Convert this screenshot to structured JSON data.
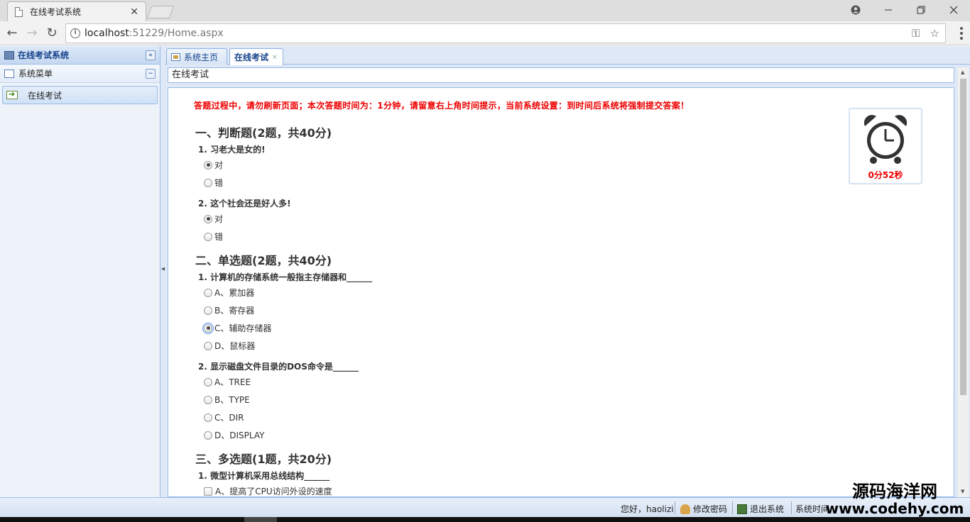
{
  "browser": {
    "tab_title": "在线考试系统",
    "tab_close": "✕",
    "url_host": "localhost",
    "url_rest": ":51229/Home.aspx"
  },
  "left_panel": {
    "title": "在线考试系统",
    "collapse_symbol": "«",
    "menu_header": "系统菜单",
    "menu_collapse_symbol": "−",
    "items": [
      {
        "label": "在线考试"
      }
    ]
  },
  "tabs": [
    {
      "label": "系统主页",
      "active": false
    },
    {
      "label": "在线考试",
      "active": true,
      "close": "×"
    }
  ],
  "content_title": "在线考试",
  "exam": {
    "notice": "答题过程中，请勿刷新页面；本次答题时间为：1分钟，请留意右上角时间提示，当前系统设置：到时间后系统将强制提交答案！",
    "timer": "0分52秒",
    "sections": [
      {
        "title": "一、判断题(2题，共40分)",
        "questions": [
          {
            "title": "1. 习老大是女的!",
            "options": [
              "对",
              "错"
            ],
            "selected": 0
          },
          {
            "title": "2. 这个社会还是好人多!",
            "options": [
              "对",
              "错"
            ],
            "selected": 0
          }
        ]
      },
      {
        "title": "二、单选题(2题，共40分)",
        "questions": [
          {
            "title": "1. 计算机的存储系统一般指主存储器和______",
            "options": [
              "A、累加器",
              "B、寄存器",
              "C、辅助存储器",
              "D、鼠标器"
            ],
            "selected": 2
          },
          {
            "title": "2. 显示磁盘文件目录的DOS命令是______",
            "options": [
              "A、TREE",
              "B、TYPE",
              "C、DIR",
              "D、DISPLAY"
            ],
            "selected": -1
          }
        ]
      },
      {
        "title": "三、多选题(1题，共20分)",
        "questions": [
          {
            "title": "1. 微型计算机采用总线结构______",
            "options": [
              "A、提高了CPU访问外设的速度"
            ],
            "selected": -1
          }
        ]
      }
    ]
  },
  "status_bar": {
    "greeting": "您好，haolizi",
    "change_password": "修改密码",
    "logout": "退出系统",
    "system_time_label": "系统时间"
  },
  "watermark": {
    "line1": "源码海洋网",
    "line2": "www.codehy.com"
  },
  "colors": {
    "accent_blue": "#99bbe8",
    "notice_red": "#ee0000"
  }
}
